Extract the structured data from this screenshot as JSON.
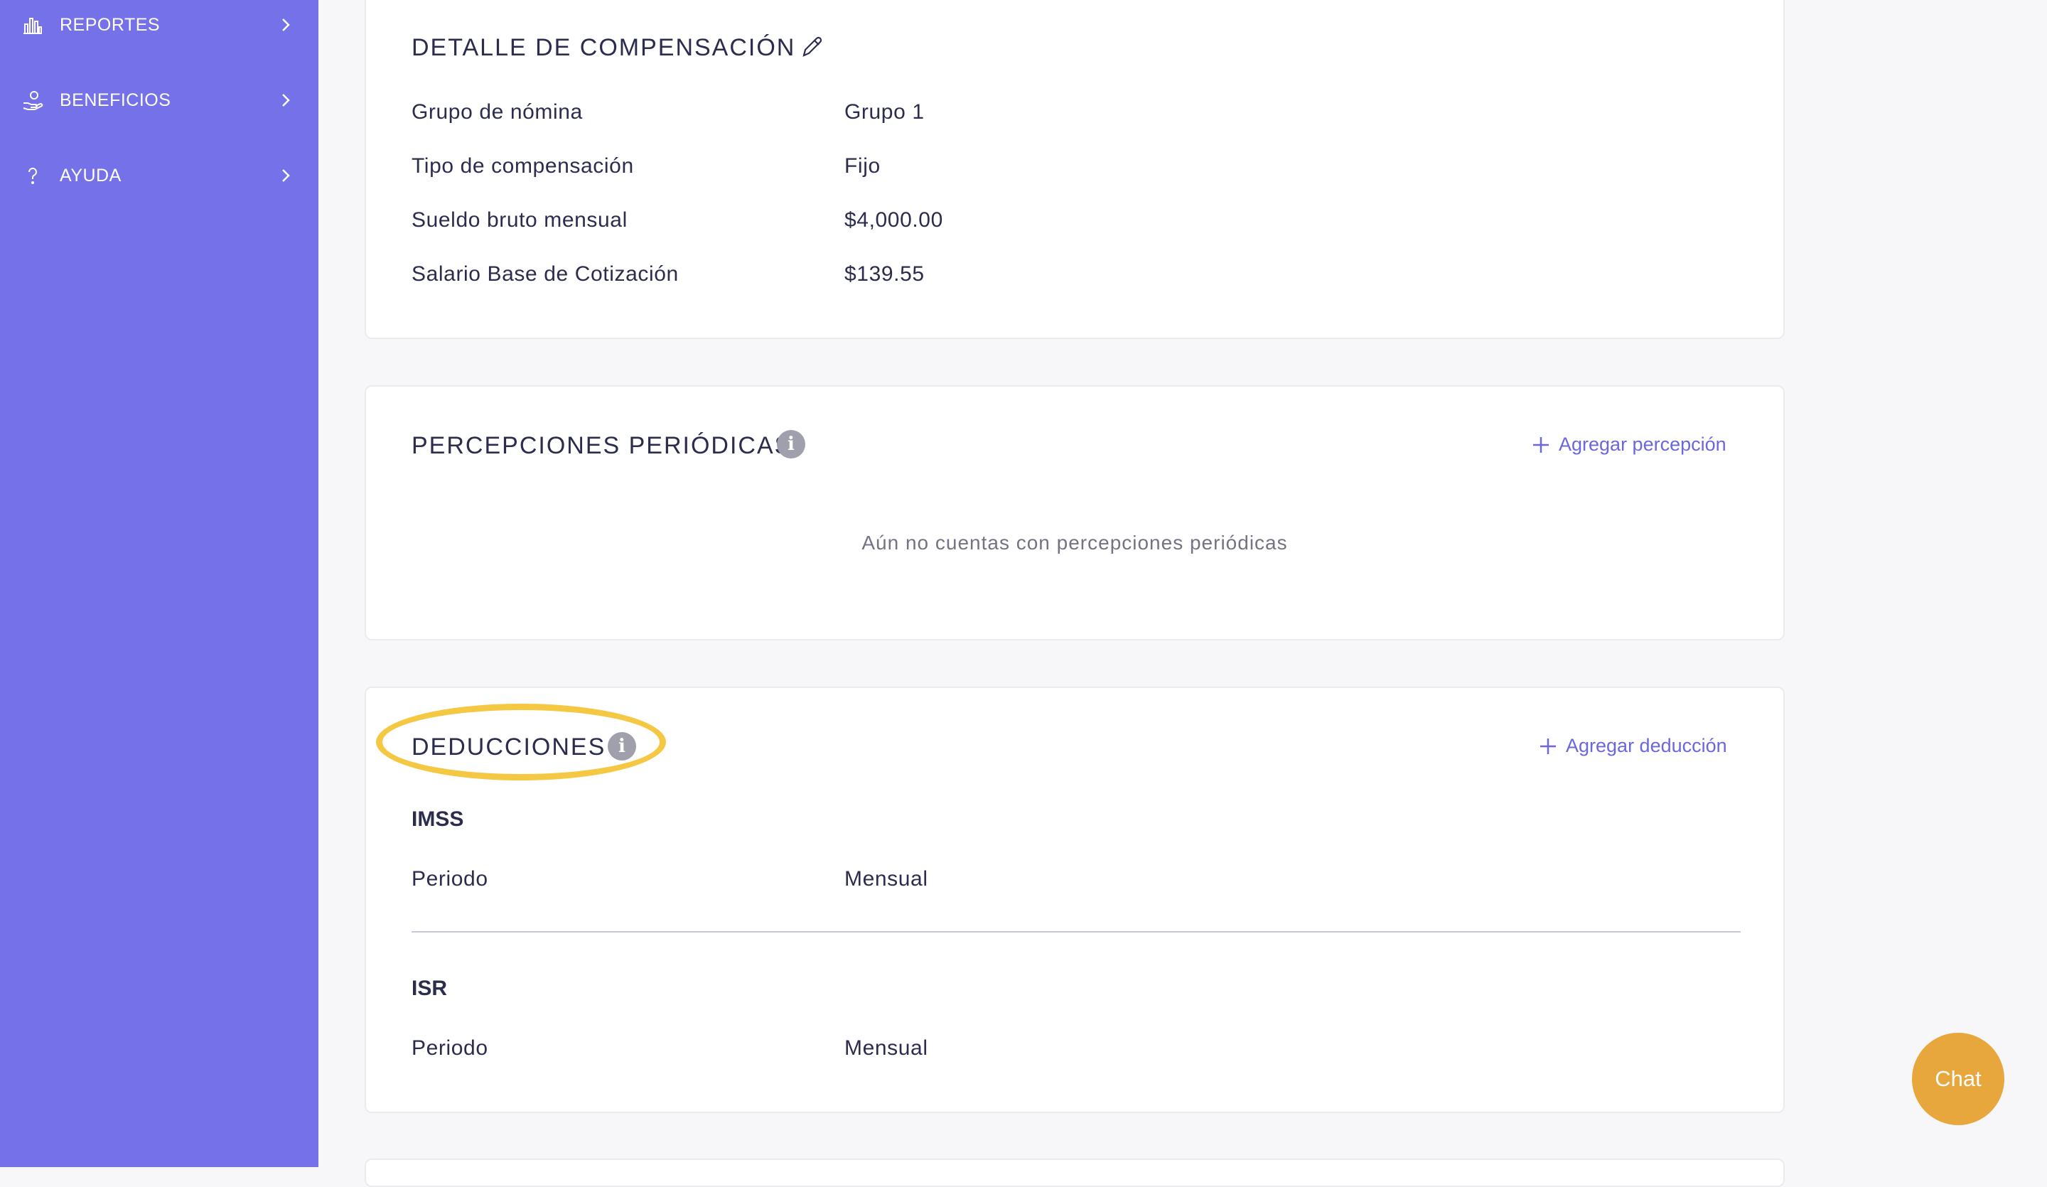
{
  "sidebar": {
    "items": [
      {
        "label": "REPORTES",
        "icon": "bar-chart-icon"
      },
      {
        "label": "BENEFICIOS",
        "icon": "hand-benefit-icon"
      },
      {
        "label": "AYUDA",
        "icon": "question-icon"
      }
    ]
  },
  "compensation": {
    "title": "DETALLE DE COMPENSACIÓN",
    "rows": [
      {
        "label": "Grupo de nómina",
        "value": "Grupo 1"
      },
      {
        "label": "Tipo de compensación",
        "value": "Fijo"
      },
      {
        "label": "Sueldo bruto mensual",
        "value": "$4,000.00"
      },
      {
        "label": "Salario Base de Cotización",
        "value": "$139.55"
      }
    ]
  },
  "perceptions": {
    "title": "PERCEPCIONES PERIÓDICAS",
    "add_label": "Agregar percepción",
    "empty_message": "Aún no cuentas con percepciones periódicas"
  },
  "deductions": {
    "title": "DEDUCCIONES",
    "add_label": "Agregar deducción",
    "items": [
      {
        "name": "IMSS",
        "period_label": "Periodo",
        "period_value": "Mensual"
      },
      {
        "name": "ISR",
        "period_label": "Periodo",
        "period_value": "Mensual"
      }
    ]
  },
  "chat": {
    "label": "Chat"
  },
  "colors": {
    "sidebar": "#7571e9",
    "accent": "#6b67dc",
    "highlight": "#f5c844",
    "chat": "#e8a73d"
  }
}
